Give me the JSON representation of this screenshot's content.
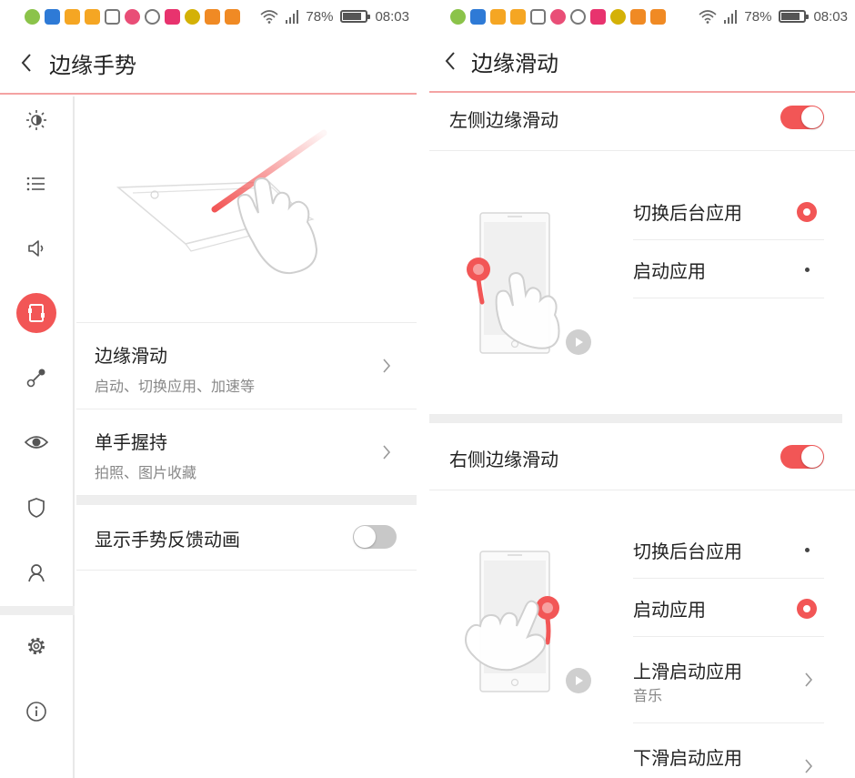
{
  "left": {
    "status": {
      "battery": "78%",
      "time": "08:03"
    },
    "title": "边缘手势",
    "menu": [
      {
        "title": "边缘滑动",
        "subtitle": "启动、切换应用、加速等"
      },
      {
        "title": "单手握持",
        "subtitle": "拍照、图片收藏"
      }
    ],
    "toggle_row": {
      "label": "显示手势反馈动画",
      "state": "off"
    },
    "sidenav_icons": [
      "brightness-icon",
      "list-icon",
      "speaker-icon",
      "gesture-icon",
      "connection-icon",
      "eye-icon",
      "shield-icon",
      "user-icon",
      "gear-icon",
      "info-icon"
    ],
    "active_nav": "gesture-icon"
  },
  "right": {
    "status": {
      "battery": "78%",
      "time": "08:03"
    },
    "title": "边缘滑动",
    "left_section": {
      "label": "左侧边缘滑动",
      "enabled": true,
      "options": [
        {
          "label": "切换后台应用",
          "selected": true
        },
        {
          "label": "启动应用",
          "selected": false
        }
      ]
    },
    "right_section": {
      "label": "右侧边缘滑动",
      "enabled": true,
      "options": [
        {
          "label": "切换后台应用",
          "selected": false
        },
        {
          "label": "启动应用",
          "selected": true
        },
        {
          "label": "上滑启动应用",
          "sub": "音乐"
        },
        {
          "label": "下滑启动应用"
        }
      ]
    }
  },
  "colors": {
    "accent": "#f25656",
    "divider": "#f4a3a3",
    "band": "#eeeeee"
  }
}
